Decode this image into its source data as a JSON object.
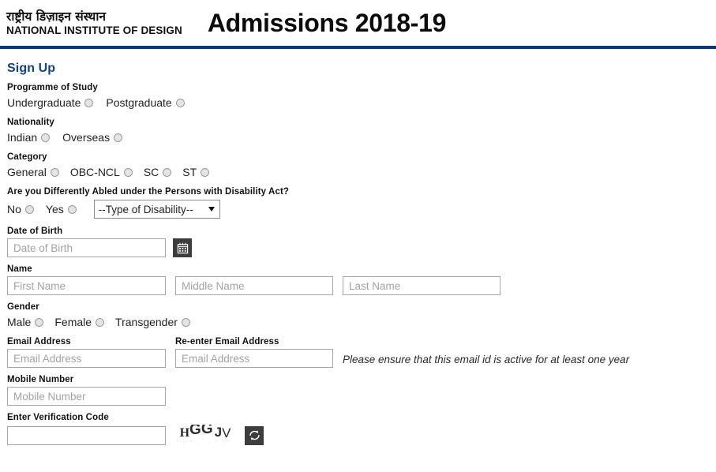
{
  "header": {
    "logo_hindi": "राष्ट्रीय डिज़ाइन संस्थान",
    "logo_english": "NATIONAL INSTITUTE OF DESIGN",
    "title": "Admissions 2018-19",
    "rule_color": "#0b3a72"
  },
  "form": {
    "signup_title": "Sign Up",
    "accent_color": "#12428e",
    "programme": {
      "label": "Programme of Study",
      "options": [
        "Undergraduate",
        "Postgraduate"
      ]
    },
    "nationality": {
      "label": "Nationality",
      "options": [
        "Indian",
        "Overseas"
      ]
    },
    "category": {
      "label": "Category",
      "options": [
        "General",
        "OBC-NCL",
        "SC",
        "ST"
      ]
    },
    "disability": {
      "label": "Are you Differently Abled under the Persons with Disability Act?",
      "options": [
        "No",
        "Yes"
      ],
      "select_value": "--Type of Disability--",
      "select_options": [
        "--Type of Disability--"
      ]
    },
    "dob": {
      "label": "Date of Birth",
      "placeholder": "Date of Birth",
      "value": "",
      "calendar_icon": "calendar-icon"
    },
    "name": {
      "label": "Name",
      "first_placeholder": "First Name",
      "middle_placeholder": "Middle Name",
      "last_placeholder": "Last Name",
      "first_value": "",
      "middle_value": "",
      "last_value": ""
    },
    "gender": {
      "label": "Gender",
      "options": [
        "Male",
        "Female",
        "Transgender"
      ]
    },
    "email": {
      "label": "Email Address",
      "placeholder": "Email Address",
      "value": "",
      "reenter_label": "Re-enter Email Address",
      "reenter_placeholder": "Email Address",
      "reenter_value": "",
      "note": "Please ensure that this email id is active for at least one year"
    },
    "mobile": {
      "label": "Mobile Number",
      "placeholder": "Mobile Number",
      "value": ""
    },
    "verification": {
      "label": "Enter Verification Code",
      "placeholder": "",
      "value": "",
      "captcha_text": "HGGJV",
      "captcha_chars": [
        "H",
        "G",
        "G",
        "J",
        "V"
      ],
      "refresh_icon": "refresh-icon"
    }
  }
}
